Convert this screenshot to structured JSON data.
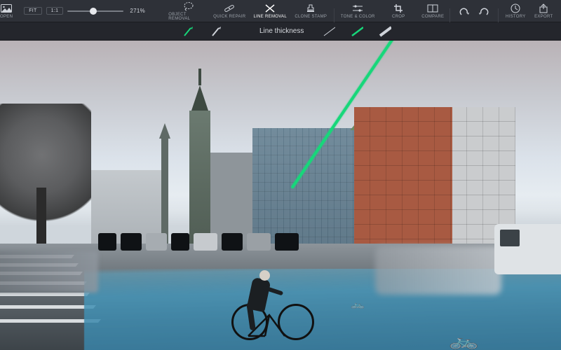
{
  "toolbar": {
    "open": "OPEN",
    "fit": "FIT",
    "one_to_one": "1:1",
    "zoom_value": "271%",
    "zoom_slider_pos": 0.46,
    "tools": {
      "object_removal": "OBJECT REMOVAL",
      "quick_repair": "QUICK REPAIR",
      "line_removal": "LINE REMOVAL",
      "clone_stamp": "CLONE STAMP",
      "tone_color": "TONE & COLOR",
      "crop": "CROP"
    },
    "right": {
      "compare": "COMPARE",
      "undo": "",
      "redo": "",
      "history": "HISTORY",
      "export": "EXPORT"
    },
    "active_tool": "line_removal"
  },
  "subbar": {
    "label": "Line thickness",
    "brush_modes": [
      "add-line",
      "remove-line"
    ],
    "thickness_options": [
      "thin",
      "medium",
      "thick"
    ],
    "selected_brush_mode": "add-line",
    "selected_thickness": "medium"
  },
  "accent_color": "#17d77a"
}
